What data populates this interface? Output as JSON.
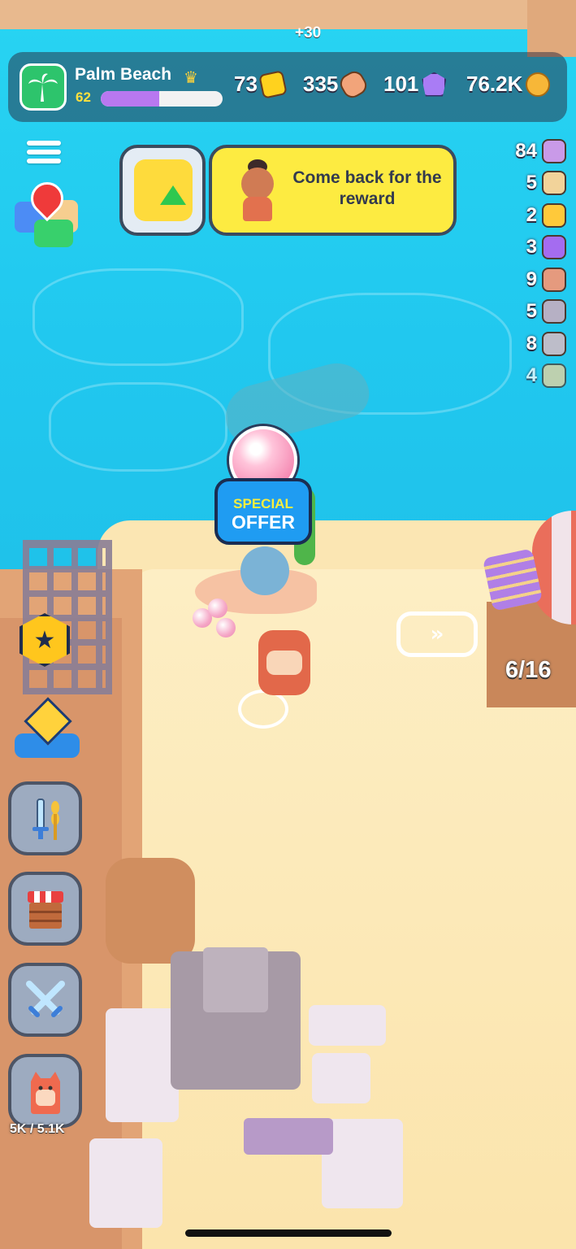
{
  "hud": {
    "island_name": "Palm Beach",
    "level": "62",
    "xp_progress": 0.48,
    "bonus_text": "+30",
    "resources": [
      {
        "id": "tickets",
        "value": "73",
        "icon": "ticket-icon",
        "color": "#ffd21e"
      },
      {
        "id": "scrolls",
        "value": "335",
        "icon": "scroll-icon",
        "color": "#f2a47a"
      },
      {
        "id": "gems",
        "value": "101",
        "icon": "gem-icon",
        "color": "#a97cf5"
      },
      {
        "id": "coins",
        "value": "76.2K",
        "icon": "coin-icon",
        "color": "#f7b738"
      }
    ]
  },
  "quest": {
    "banner_text": "Come back for the reward"
  },
  "inventory": [
    {
      "count": "84",
      "icon": "shell-icon",
      "color": "#c99ae8"
    },
    {
      "count": "5",
      "icon": "map-scroll-icon",
      "color": "#f2d39a"
    },
    {
      "count": "2",
      "icon": "gear-token-icon",
      "color": "#ffc93a"
    },
    {
      "count": "3",
      "icon": "lightning-token-icon",
      "color": "#a46cf0"
    },
    {
      "count": "9",
      "icon": "rope-icon",
      "color": "#e59a7e"
    },
    {
      "count": "5",
      "icon": "spring-icon",
      "color": "#b6b0c4"
    },
    {
      "count": "8",
      "icon": "metal-bar-icon",
      "color": "#bdbdc9"
    },
    {
      "count": "4",
      "icon": "sand-icon",
      "color": "#f2d39a"
    }
  ],
  "offer": {
    "line1": "SPECIAL",
    "line2": "OFFER"
  },
  "world": {
    "capacity": "6/16",
    "backpack": "5K / 5.1K"
  },
  "colors": {
    "water": "#21c8ef",
    "sand": "#fbe6b3",
    "quest_banner": "#fdeb41",
    "offer_box": "#1f9cf2"
  }
}
